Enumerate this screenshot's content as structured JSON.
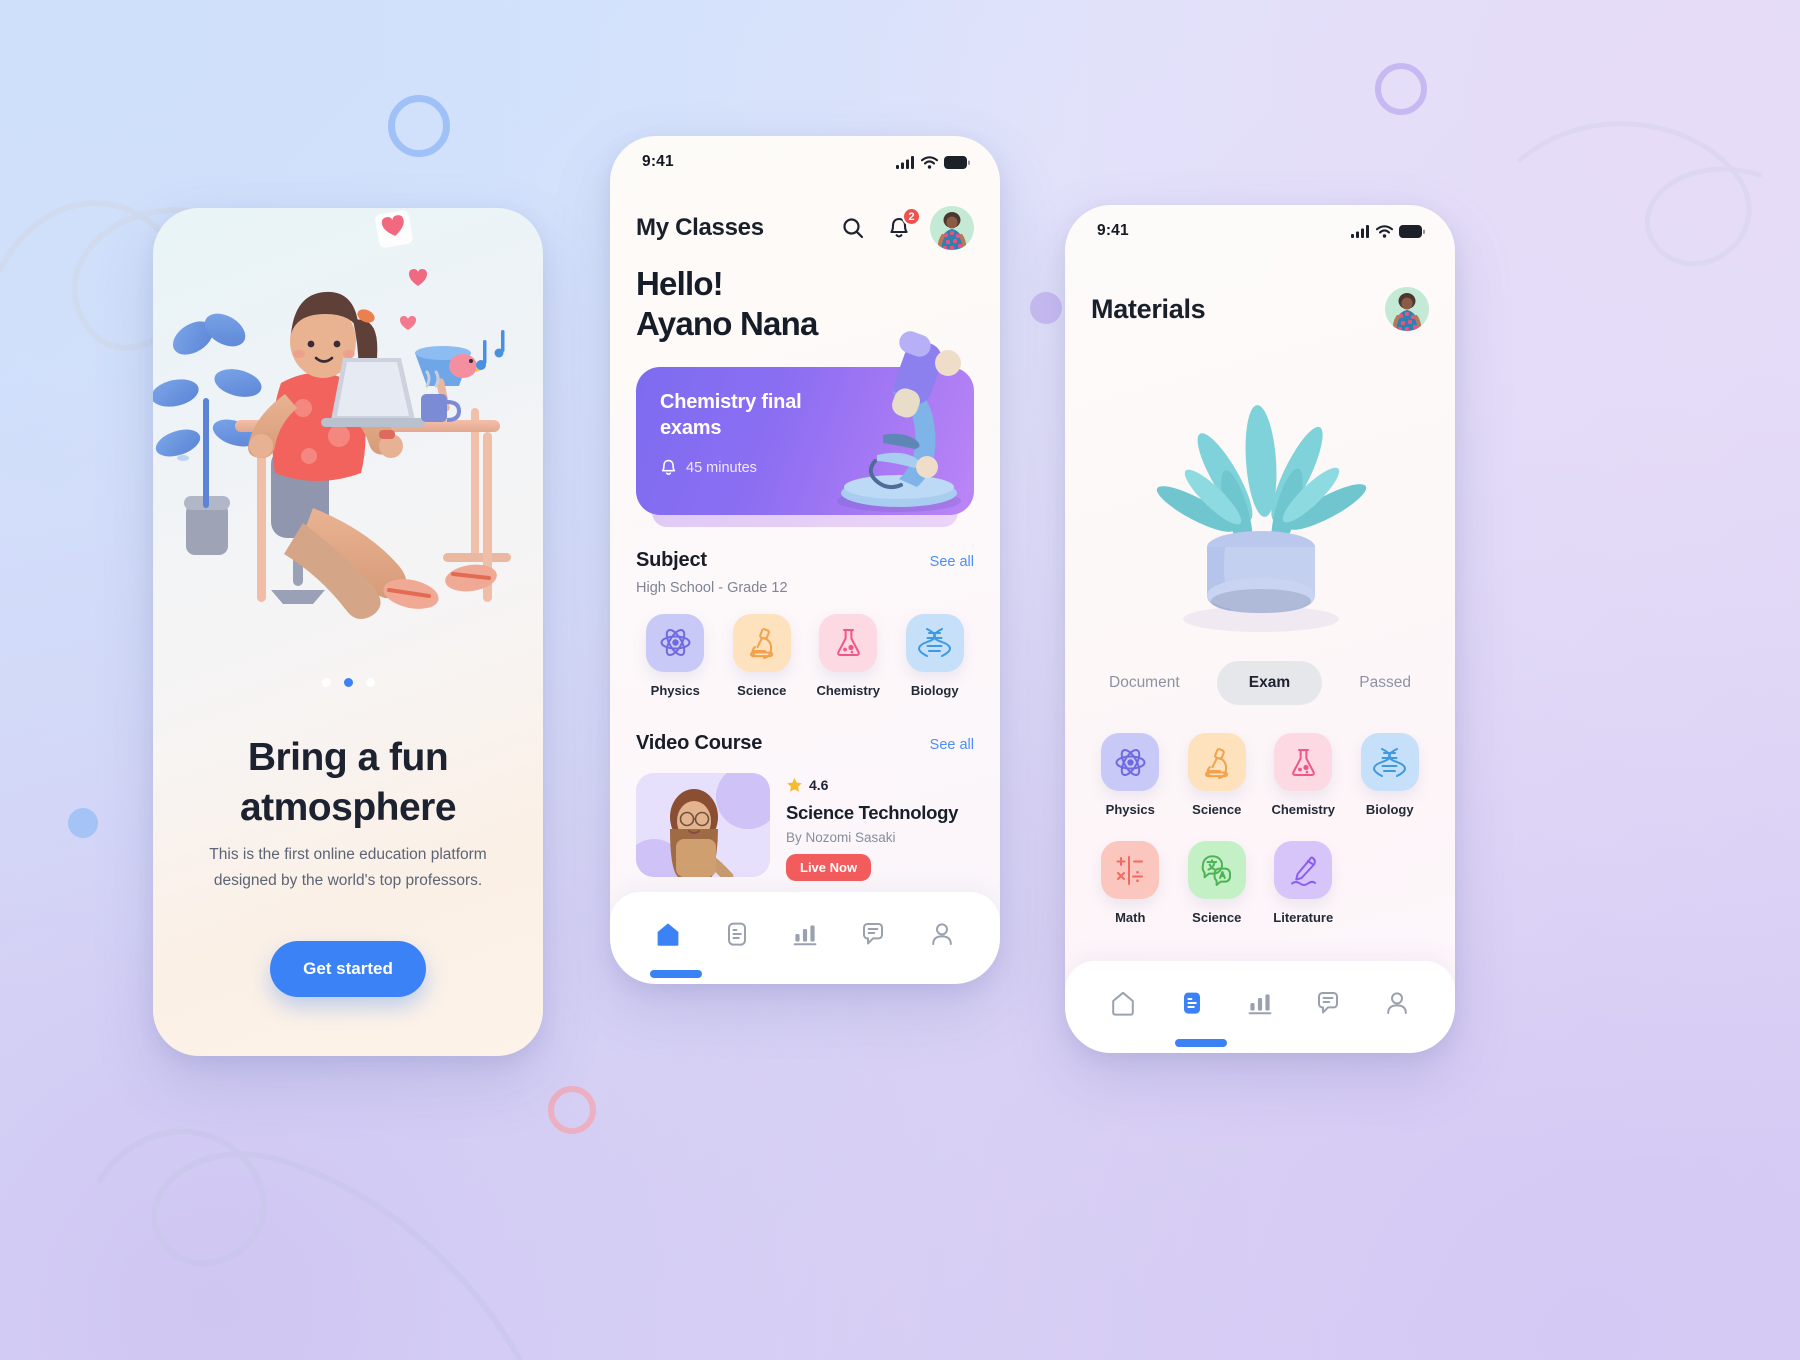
{
  "background": {
    "accent_blue": "#3b82f6",
    "gradient_from": "#cfe1fc",
    "gradient_to": "#d8cdf4"
  },
  "phone_onboarding": {
    "name": "onboarding-screen",
    "title": "Bring a fun atmosphere",
    "subtitle": "This is the first online education platform designed by the world's top professors.",
    "cta_label": "Get started",
    "pagination": {
      "total": 3,
      "active_index": 1
    }
  },
  "phone_classes": {
    "name": "my-classes-screen",
    "statusbar": {
      "time": "9:41",
      "icons": [
        "cellular-icon",
        "wifi-icon",
        "battery-icon"
      ]
    },
    "header": {
      "title": "My Classes",
      "search_icon": "search-icon",
      "bell_icon": "bell-icon",
      "notification_count": "2",
      "avatar": "user-avatar"
    },
    "greeting_line1": "Hello!",
    "greeting_line2": "Ayano Nana",
    "promo": {
      "title": "Chemistry final exams",
      "time_label": "45 minutes",
      "bell_icon": "bell-icon",
      "illustration": "microscope-3d",
      "color_from": "#7d6cf0",
      "color_to": "#bb86f6"
    },
    "subject_section": {
      "title": "Subject",
      "see_all": "See all",
      "subtitle": "High School - Grade 12",
      "items": [
        {
          "label": "Physics",
          "icon": "atom-icon",
          "tile_color": "#c9c9f8",
          "icon_color": "#6f6ae0"
        },
        {
          "label": "Science",
          "icon": "microscope-icon",
          "tile_color": "#fde2bd",
          "icon_color": "#f3a14a"
        },
        {
          "label": "Chemistry",
          "icon": "flask-icon",
          "tile_color": "#fcd9e3",
          "icon_color": "#f0568c"
        },
        {
          "label": "Biology",
          "icon": "dna-icon",
          "tile_color": "#c5e0f8",
          "icon_color": "#3d9ae0"
        }
      ]
    },
    "video_section": {
      "title": "Video Course",
      "see_all": "See all",
      "course": {
        "rating": "4.6",
        "star_icon": "star-icon",
        "name": "Science Technology",
        "author": "By Nozomi Sasaki",
        "badge": "Live Now",
        "badge_color": "#f35c5c",
        "thumbnail": "instructor-photo"
      }
    },
    "bottom_nav": {
      "items": [
        {
          "icon": "home-icon",
          "active": true
        },
        {
          "icon": "document-icon",
          "active": false
        },
        {
          "icon": "chart-icon",
          "active": false
        },
        {
          "icon": "chat-icon",
          "active": false
        },
        {
          "icon": "profile-icon",
          "active": false
        }
      ]
    }
  },
  "phone_materials": {
    "name": "materials-screen",
    "statusbar": {
      "time": "9:41",
      "icons": [
        "cellular-icon",
        "wifi-icon",
        "battery-icon"
      ]
    },
    "header": {
      "title": "Materials",
      "avatar": "user-avatar"
    },
    "illustration": "potted-plant-3d",
    "tabs": [
      {
        "label": "Document",
        "active": false
      },
      {
        "label": "Exam",
        "active": true
      },
      {
        "label": "Passed",
        "active": false
      }
    ],
    "grid": [
      {
        "label": "Physics",
        "icon": "atom-icon",
        "tile_color": "#c9c9f8",
        "icon_color": "#6f6ae0"
      },
      {
        "label": "Science",
        "icon": "microscope-icon",
        "tile_color": "#fde2bd",
        "icon_color": "#f3a14a"
      },
      {
        "label": "Chemistry",
        "icon": "flask-icon",
        "tile_color": "#fcd9e3",
        "icon_color": "#f0568c"
      },
      {
        "label": "Biology",
        "icon": "dna-icon",
        "tile_color": "#c5e0f8",
        "icon_color": "#3d9ae0"
      },
      {
        "label": "Math",
        "icon": "math-symbols-icon",
        "tile_color": "#fbc6bd",
        "icon_color": "#ef6a63"
      },
      {
        "label": "Science",
        "icon": "translate-icon",
        "tile_color": "#c4f0c5",
        "icon_color": "#4cb356"
      },
      {
        "label": "Literature",
        "icon": "pen-icon",
        "tile_color": "#d7c5fa",
        "icon_color": "#8b5cf6"
      }
    ],
    "bottom_nav": {
      "items": [
        {
          "icon": "home-icon",
          "active": false
        },
        {
          "icon": "document-icon",
          "active": true
        },
        {
          "icon": "chart-icon",
          "active": false
        },
        {
          "icon": "chat-icon",
          "active": false
        },
        {
          "icon": "profile-icon",
          "active": false
        }
      ]
    }
  }
}
